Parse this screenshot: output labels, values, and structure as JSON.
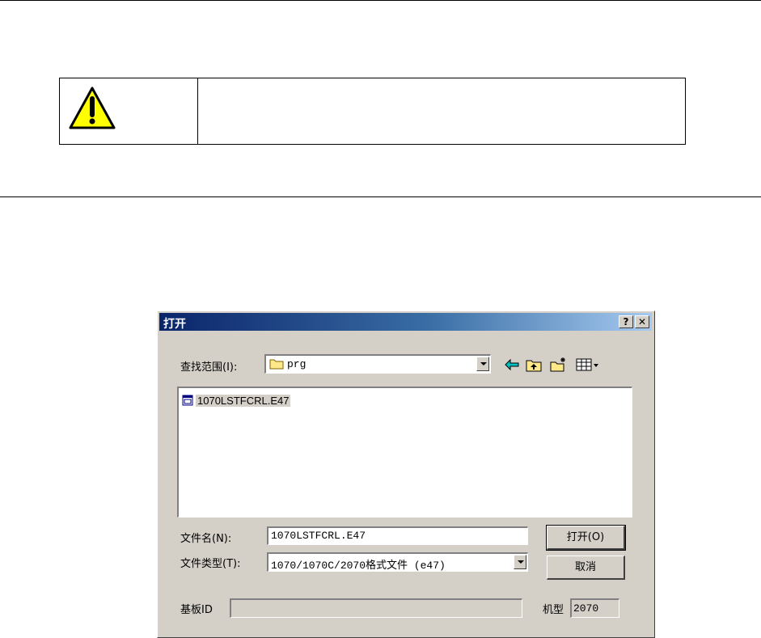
{
  "dialog": {
    "title": "打开",
    "help_button": "?",
    "close_button": "✕",
    "look_in": {
      "label": "查找范围(I):",
      "value": "prg"
    },
    "toolbar": {
      "back_icon": "back-arrow-icon",
      "up_icon": "up-folder-icon",
      "new_folder_icon": "new-folder-icon",
      "view_menu_icon": "view-menu-icon"
    },
    "files": [
      {
        "name": "1070LSTFCRL.E47"
      }
    ],
    "filename": {
      "label": "文件名(N):",
      "value": "1070LSTFCRL.E47"
    },
    "filetype": {
      "label": "文件类型(T):",
      "value": "1070/1070C/2070格式文件 (e47)"
    },
    "open_button": "打开(O)",
    "cancel_button": "取消",
    "board_id": {
      "label": "基板ID",
      "value": ""
    },
    "model": {
      "label": "机型",
      "value": "2070"
    }
  },
  "colors": {
    "dialog_face": "#d4d0c8",
    "titlebar_start": "#0a246a",
    "titlebar_end": "#a6caf0",
    "warning_yellow": "#ffff00"
  }
}
